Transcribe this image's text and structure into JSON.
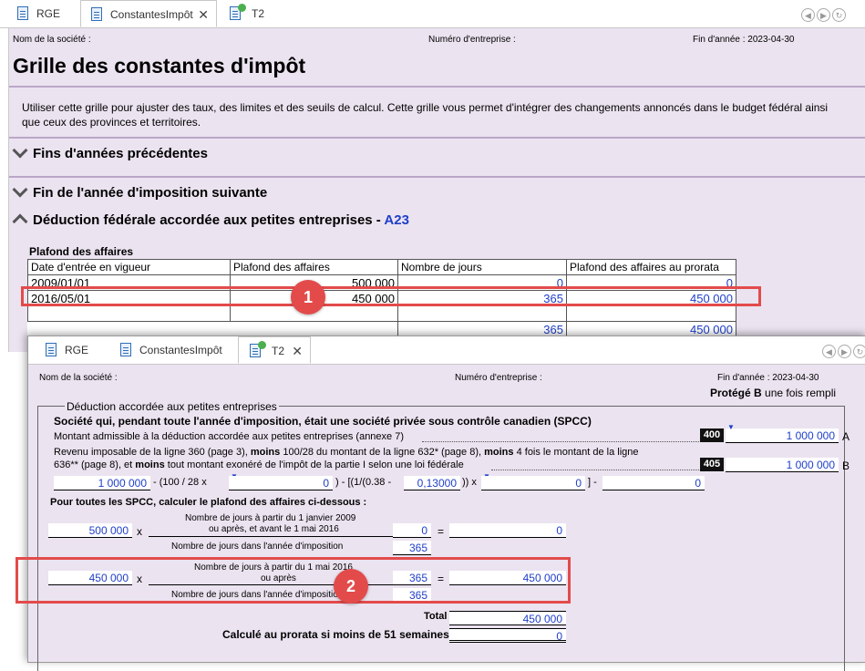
{
  "top": {
    "tabs": [
      {
        "label": "RGE"
      },
      {
        "label": "ConstantesImpôt"
      },
      {
        "label": "T2"
      }
    ],
    "header": {
      "company_label": "Nom de la société :",
      "business_number_label": "Numéro d'entreprise :",
      "year_end": "Fin d'année : 2023-04-30"
    },
    "title": "Grille des constantes d'impôt",
    "description": "Utiliser cette grille pour ajuster des taux, des limites et des seuils de calcul. Cette grille vous permet d'intégrer des changements annoncés dans le budget fédéral ainsi que ceux des provinces et territoires.",
    "sections": [
      {
        "label": "Fins d'années précédentes"
      },
      {
        "label": "Fin de l'année d'imposition suivante"
      },
      {
        "label": "Déduction fédérale accordée aux petites entreprises - ",
        "code": "A23"
      }
    ],
    "table": {
      "caption": "Plafond des affaires",
      "headers": [
        "Date d'entrée en vigueur",
        "Plafond des affaires",
        "Nombre de jours",
        "Plafond des affaires au prorata"
      ],
      "rows": [
        [
          "2009/01/01",
          "500 000",
          "0",
          "0"
        ],
        [
          "2016/05/01",
          "450 000",
          "365",
          "450 000"
        ],
        [
          "",
          "",
          "",
          ""
        ]
      ],
      "totals": [
        "365",
        "450 000"
      ]
    }
  },
  "bottom": {
    "tabs": [
      {
        "label": "RGE"
      },
      {
        "label": "ConstantesImpôt"
      },
      {
        "label": "T2"
      }
    ],
    "header": {
      "company_label": "Nom de la société :",
      "business_number_label": "Numéro d'entreprise :",
      "year_end": "Fin d'année : 2023-04-30",
      "protected_bold": "Protégé B",
      "protected_rest": " une fois rempli"
    },
    "group_title": "Déduction accordée aux petites entreprises",
    "spcc_title": "Société qui, pendant toute l'année d'imposition, était une société privée sous contrôle canadien (SPCC)",
    "line400": {
      "text": "Montant admissible à la déduction accordée aux petites entreprises (annexe 7)",
      "code": "400",
      "value": "1 000 000",
      "letter": "A"
    },
    "line405": {
      "text1_a": "Revenu imposable de la ligne 360 (page 3), ",
      "text1_b": "moins",
      "text1_c": " 100/28 du montant de la ligne 632* (page 8), ",
      "text1_d": "moins",
      "text1_e": " 4 fois le montant de la ligne",
      "text2_a": "636** (page 8), et ",
      "text2_b": "moins",
      "text2_c": " tout montant exonéré de l'impôt de la partie I selon une loi fédérale",
      "code": "405",
      "value": "1 000 000",
      "letter": "B"
    },
    "formula": {
      "v1": "1 000 000",
      "t1": "- (100 / 28 x",
      "v2": "0",
      "t2": ") - [(1/(0.38 -",
      "v3": "0,13000",
      "t3": ")) x",
      "v4": "0",
      "t4": "] -",
      "v5": "0"
    },
    "spcc_calc_title": "Pour toutes les SPCC, calculer le plafond des affaires ci-dessous :",
    "calc1": {
      "amount": "500 000",
      "x": "x",
      "num_label_1": "Nombre de jours à partir du 1 janvier 2009",
      "num_label_2": "ou après, et avant le 1 mai 2016",
      "den_label": "Nombre de jours dans l'année d'imposition",
      "num_value": "0",
      "den_value": "365",
      "eq": "=",
      "result": "0"
    },
    "calc2": {
      "amount": "450 000",
      "x": "x",
      "num_label_1": "Nombre de jours à partir du 1 mai 2016",
      "num_label_2": "ou après",
      "den_label": "Nombre de jours dans l'année d'imposition",
      "num_value": "365",
      "den_value": "365",
      "eq": "=",
      "result": "450 000"
    },
    "total_label": "Total",
    "total_value": "450 000",
    "prorata_label": "Calculé au prorata si moins de 51 semaines",
    "prorata_value": "0"
  },
  "callouts": [
    "1",
    "2"
  ],
  "colors": {
    "panel": "#ebe3f0",
    "highlight": "#e34b4b",
    "value_blue": "#1f3fc9"
  }
}
